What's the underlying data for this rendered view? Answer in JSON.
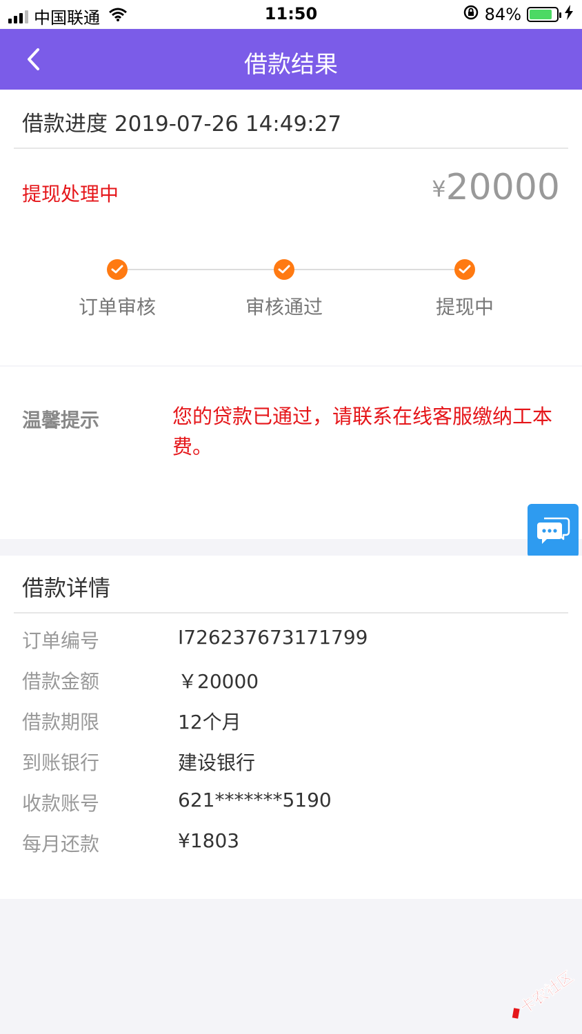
{
  "status_bar": {
    "carrier": "中国联通",
    "time": "11:50",
    "battery": "84%",
    "battery_level": 0.84
  },
  "nav": {
    "title": "借款结果"
  },
  "progress": {
    "header": "借款进度 2019-07-26 14:49:27",
    "status": "提现处理中",
    "currency": "¥",
    "amount": "20000",
    "steps": [
      {
        "label": "订单审核"
      },
      {
        "label": "审核通过"
      },
      {
        "label": "提现中"
      }
    ]
  },
  "tip": {
    "label": "温馨提示",
    "text": "您的贷款已通过，请联系在线客服缴纳工本费。"
  },
  "details": {
    "title": "借款详情",
    "rows": [
      {
        "key": "订单编号",
        "value": "I726237673171799"
      },
      {
        "key": "借款金额",
        "value": "￥20000"
      },
      {
        "key": "借款期限",
        "value": "12个月"
      },
      {
        "key": "到账银行",
        "value": "建设银行"
      },
      {
        "key": "收款账号",
        "value": "621*******5190"
      },
      {
        "key": "每月还款",
        "value": "¥1803"
      }
    ]
  },
  "watermark": {
    "text": "卡农社区"
  },
  "colors": {
    "nav_bg": "#7b5ce8",
    "step_dot": "#ff7a12",
    "alert_red": "#e5161a",
    "chat_blue": "#2e9bf0"
  }
}
